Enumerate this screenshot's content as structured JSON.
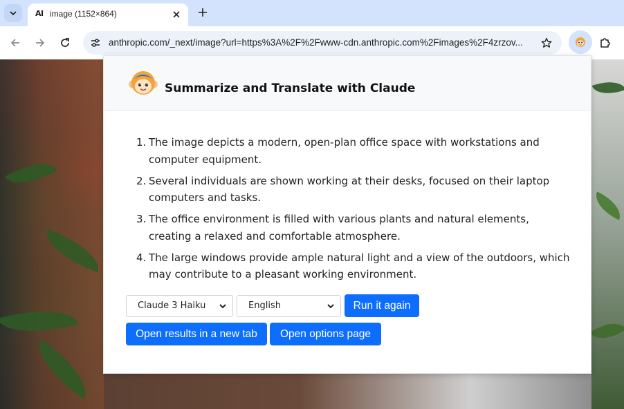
{
  "browser": {
    "tab": {
      "title": "image (1152×864)",
      "favicon_text": "AI"
    },
    "url": "anthropic.com/_next/image?url=https%3A%2F%2Fwww-cdn.anthropic.com%2Fimages%2F4zrzov..."
  },
  "popup": {
    "title": "Summarize and Translate with Claude",
    "summary": [
      {
        "num": "1.",
        "text": "The image depicts a modern, open-plan office space with workstations and computer equipment."
      },
      {
        "num": "2.",
        "text": "Several individuals are shown working at their desks, focused on their laptop computers and tasks."
      },
      {
        "num": "3.",
        "text": "The office environment is filled with various plants and natural elements, creating a relaxed and comfortable atmosphere."
      },
      {
        "num": "4.",
        "text": "The large windows provide ample natural light and a view of the outdoors, which may contribute to a pleasant working environment."
      }
    ],
    "model_select": {
      "value": "Claude 3 Haiku"
    },
    "language_select": {
      "value": "English"
    },
    "run_again_label": "Run it again",
    "open_results_label": "Open results in a new tab",
    "open_options_label": "Open options page"
  },
  "colors": {
    "primary": "#0d6efd",
    "tabstrip": "#d3e3fd",
    "omnibox": "#edf2fa"
  }
}
